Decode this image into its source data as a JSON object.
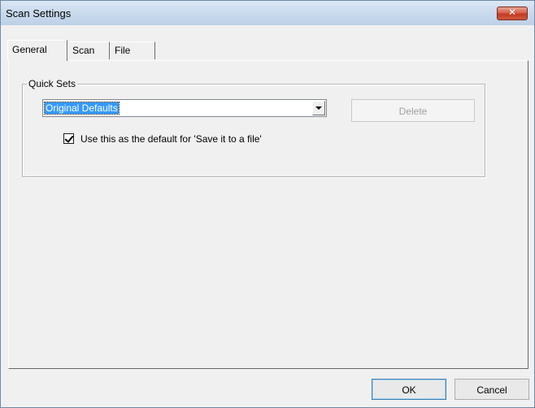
{
  "window": {
    "title": "Scan Settings",
    "close_symbol": "✕"
  },
  "tabs": [
    {
      "label": "General",
      "active": true
    },
    {
      "label": "Scan",
      "active": false
    },
    {
      "label": "File",
      "active": false
    }
  ],
  "quick_sets": {
    "group_label": "Quick Sets",
    "selected": "Original Defaults",
    "delete_label": "Delete",
    "checkbox_label": "Use this as the default for 'Save it to a file'",
    "checkbox_checked": true
  },
  "footer": {
    "ok_label": "OK",
    "cancel_label": "Cancel"
  }
}
